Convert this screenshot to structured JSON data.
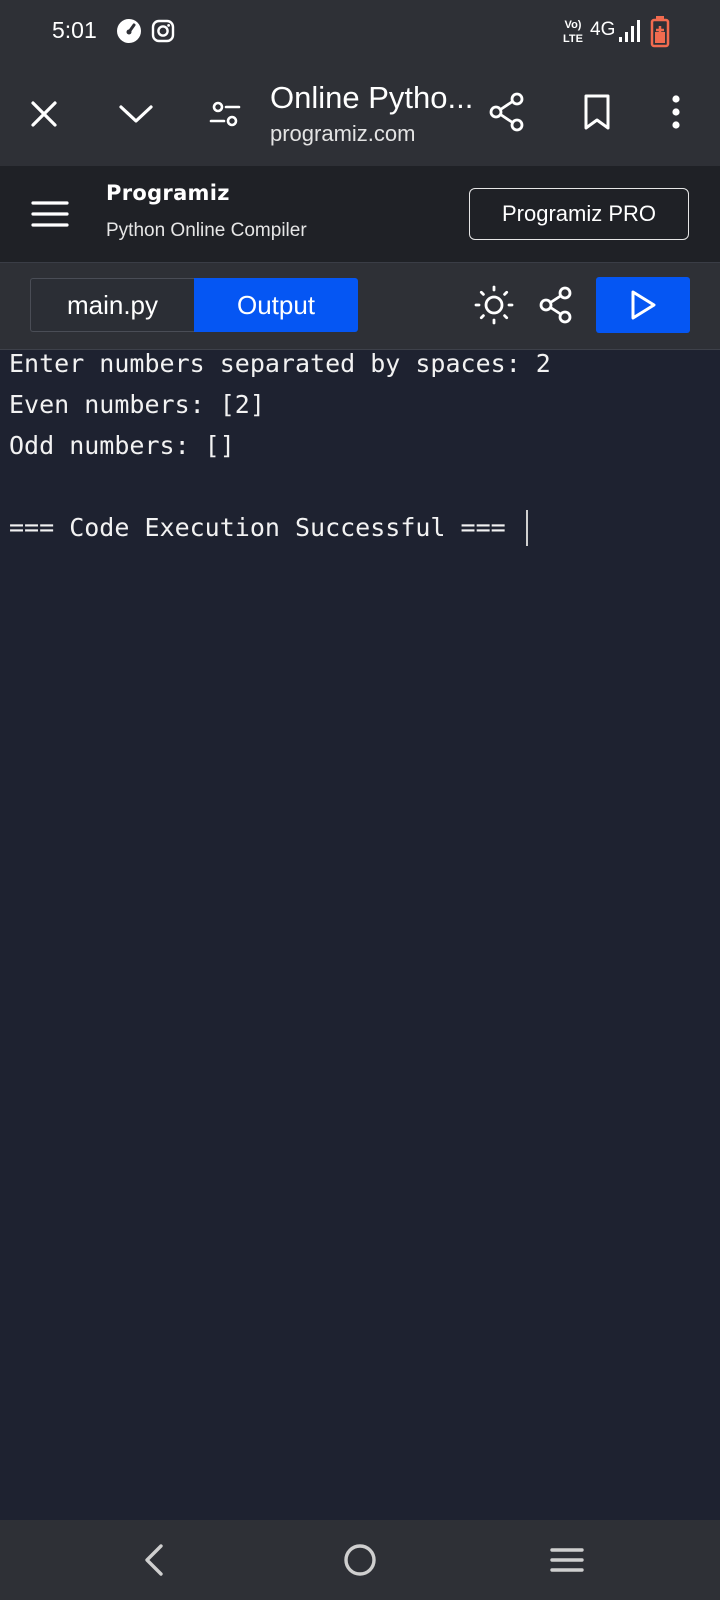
{
  "status_bar": {
    "time": "5:01",
    "network_label": "4G",
    "volte_label": "VoLTE",
    "icons": [
      "speedometer-icon",
      "instagram-icon",
      "volte-icon",
      "signal-icon",
      "battery-icon"
    ]
  },
  "browser": {
    "title": "Online Pytho...",
    "url": "programiz.com",
    "icons": [
      "close-icon",
      "chevron-down-icon",
      "site-settings-icon",
      "share-icon",
      "bookmark-icon",
      "more-icon"
    ]
  },
  "site_header": {
    "brand": "Programiz",
    "subtitle": "Python Online Compiler",
    "pro_button_label": "Programiz PRO"
  },
  "tabs": {
    "file_tab_label": "main.py",
    "output_tab_label": "Output",
    "active": "Output"
  },
  "output": {
    "lines": [
      "Enter numbers separated by spaces: 2",
      "Even numbers: [2]",
      "Odd numbers: []",
      "",
      "=== Code Execution Successful ==="
    ]
  },
  "colors": {
    "accent": "#0556f3",
    "background": "#1e2230",
    "toolbar": "#2e3036",
    "battery": "#f26b4f"
  }
}
